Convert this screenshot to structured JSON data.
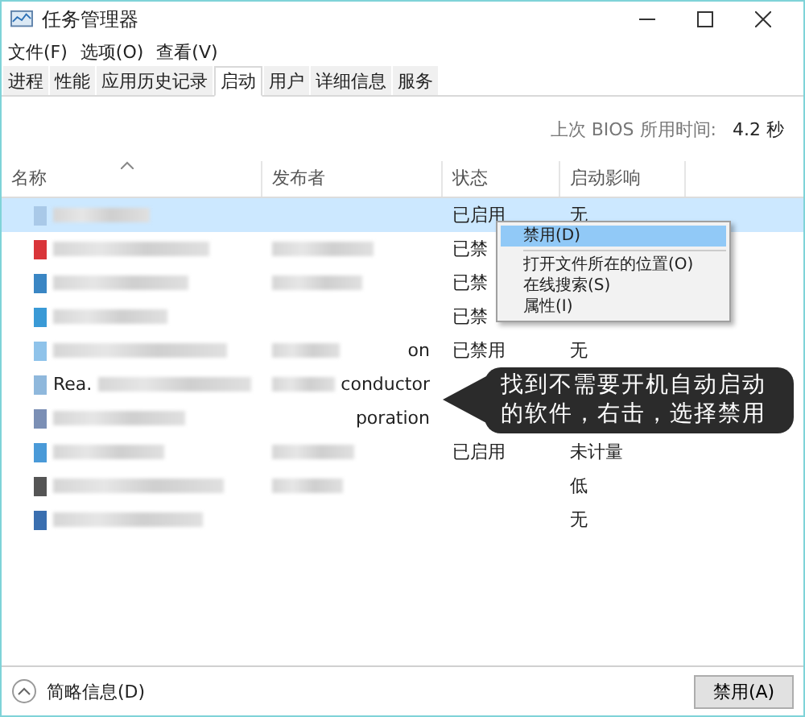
{
  "window": {
    "title": "任务管理器"
  },
  "menu": [
    "文件(F)",
    "选项(O)",
    "查看(V)"
  ],
  "tabs": [
    {
      "label": "进程",
      "selected": false
    },
    {
      "label": "性能",
      "selected": false
    },
    {
      "label": "应用历史记录",
      "selected": false
    },
    {
      "label": "启动",
      "selected": true
    },
    {
      "label": "用户",
      "selected": false
    },
    {
      "label": "详细信息",
      "selected": false
    },
    {
      "label": "服务",
      "selected": false
    }
  ],
  "bios": {
    "label": "上次 BIOS 所用时间:",
    "value": "4.2 秒"
  },
  "table": {
    "columns": [
      "名称",
      "发布者",
      "状态",
      "启动影响"
    ],
    "rows": [
      {
        "selected": true,
        "color": "#a9c9e8",
        "name": "",
        "publisher": "",
        "status": "已启用",
        "impact": "无"
      },
      {
        "selected": false,
        "color": "#d9353a",
        "name": "",
        "publisher": "",
        "status": "已禁",
        "impact": ""
      },
      {
        "selected": false,
        "color": "#3a86c4",
        "name": "",
        "publisher": "",
        "status": "已禁",
        "impact": ""
      },
      {
        "selected": false,
        "color": "#3a9ad6",
        "name": "",
        "publisher": "",
        "status": "已禁",
        "impact": ""
      },
      {
        "selected": false,
        "color": "#8fc3ea",
        "name": "",
        "publisher": "on",
        "status": "已禁用",
        "impact": "无"
      },
      {
        "selected": false,
        "color": "#8fb8dc",
        "name": "Rea.",
        "publisher": "conductor",
        "status": "",
        "impact": ""
      },
      {
        "selected": false,
        "color": "#7b8fb5",
        "name": "",
        "publisher": "poration",
        "status": "",
        "impact": ""
      },
      {
        "selected": false,
        "color": "#4a9ad8",
        "name": "",
        "publisher": "",
        "status": "已启用",
        "impact": "未计量"
      },
      {
        "selected": false,
        "color": "#555555",
        "name": "",
        "publisher": "",
        "status": "",
        "impact": "低"
      },
      {
        "selected": false,
        "color": "#3a6fb0",
        "name": "",
        "publisher": "",
        "status": "",
        "impact": "无"
      }
    ]
  },
  "context_menu": [
    {
      "label": "禁用(D)",
      "selected": true
    },
    {
      "label": "打开文件所在的位置(O)",
      "selected": false
    },
    {
      "label": "在线搜索(S)",
      "selected": false
    },
    {
      "label": "属性(I)",
      "selected": false
    }
  ],
  "callout": "找到不需要开机自动启动的软件，右击，选择禁用",
  "footer": {
    "details": "简略信息(D)",
    "button": "禁用(A)"
  }
}
